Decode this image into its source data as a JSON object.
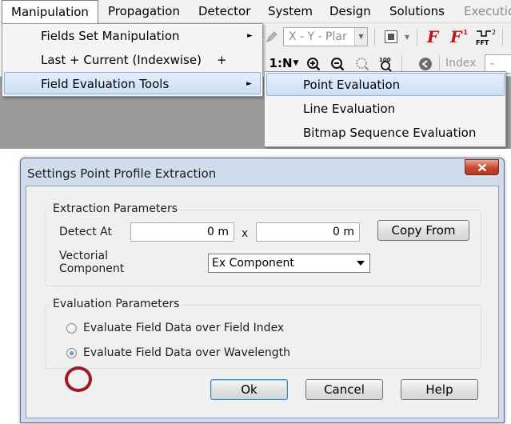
{
  "menubar": {
    "items": [
      "Manipulation",
      "Propagation",
      "Detector",
      "System",
      "Design",
      "Solutions",
      "Executio"
    ]
  },
  "toolbar": {
    "coord_combo": "X - Y - Plar",
    "index_label": "Index",
    "index_value": "-",
    "step_label": "1:N"
  },
  "manipulation_menu": {
    "items": [
      {
        "label": "Fields Set Manipulation",
        "submenu": true,
        "shortcut": ""
      },
      {
        "label": "Last + Current (Indexwise)",
        "submenu": false,
        "shortcut": "+"
      },
      {
        "label": "Field Evaluation Tools",
        "submenu": true,
        "shortcut": ""
      }
    ]
  },
  "evaluation_submenu": {
    "items": [
      "Point Evaluation",
      "Line Evaluation",
      "Bitmap Sequence Evaluation"
    ]
  },
  "dialog": {
    "title": "Settings Point Profile Extraction",
    "extraction_group": {
      "title": "Extraction Parameters",
      "detect_at_label": "Detect At",
      "detect_x": "0 m",
      "detect_separator": "x",
      "detect_y": "0 m",
      "copy_from_label": "Copy From",
      "vectorial_label_line1": "Vectorial",
      "vectorial_label_line2": "Component",
      "vectorial_value": "Ex Component"
    },
    "evaluation_group": {
      "title": "Evaluation Parameters",
      "option_index": "Evaluate Field Data over Field Index",
      "option_wavelength": "Evaluate Field Data over Wavelength",
      "selected": "wavelength"
    },
    "buttons": {
      "ok": "Ok",
      "cancel": "Cancel",
      "help": "Help"
    }
  },
  "colors": {
    "menu_highlight": "#cddff6",
    "dialog_frame": "#cfdceb",
    "close_button": "#c9452c",
    "annotation_ring": "#9b1b24"
  }
}
